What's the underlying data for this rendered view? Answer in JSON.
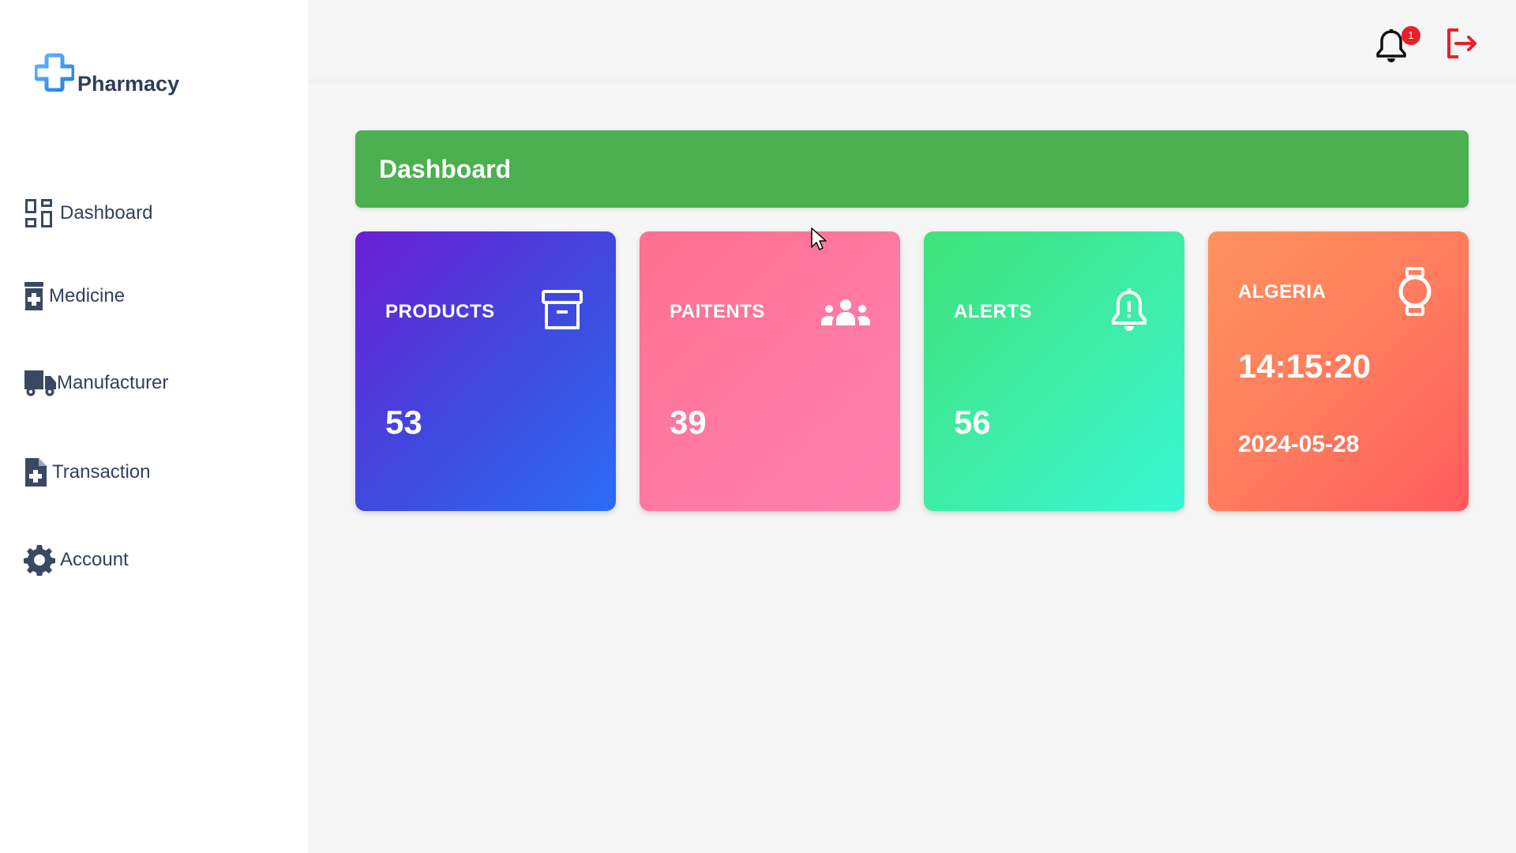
{
  "brand": {
    "name": "Pharmacy",
    "logo_icon": "medical-cross-icon"
  },
  "sidebar": {
    "items": [
      {
        "label": "Dashboard",
        "icon": "dashboard-icon"
      },
      {
        "label": "Medicine",
        "icon": "medicine-bottle-icon"
      },
      {
        "label": "Manufacturer",
        "icon": "truck-icon"
      },
      {
        "label": "Transaction",
        "icon": "file-medical-icon"
      },
      {
        "label": "Account",
        "icon": "gear-icon"
      }
    ]
  },
  "topbar": {
    "notifications": {
      "icon": "bell-icon",
      "badge_count": "1"
    },
    "logout_icon": "logout-icon"
  },
  "header": {
    "title": "Dashboard",
    "color": "#4caf50"
  },
  "cards": [
    {
      "title": "PRODUCTS",
      "value": "53",
      "icon": "archive-box-icon"
    },
    {
      "title": "PAITENTS",
      "value": "39",
      "icon": "users-group-icon"
    },
    {
      "title": "ALERTS",
      "value": "56",
      "icon": "bell-exclamation-icon"
    },
    {
      "title": "ALGERIA",
      "time": "14:15:20",
      "date": "2024-05-28",
      "icon": "watch-icon"
    }
  ]
}
